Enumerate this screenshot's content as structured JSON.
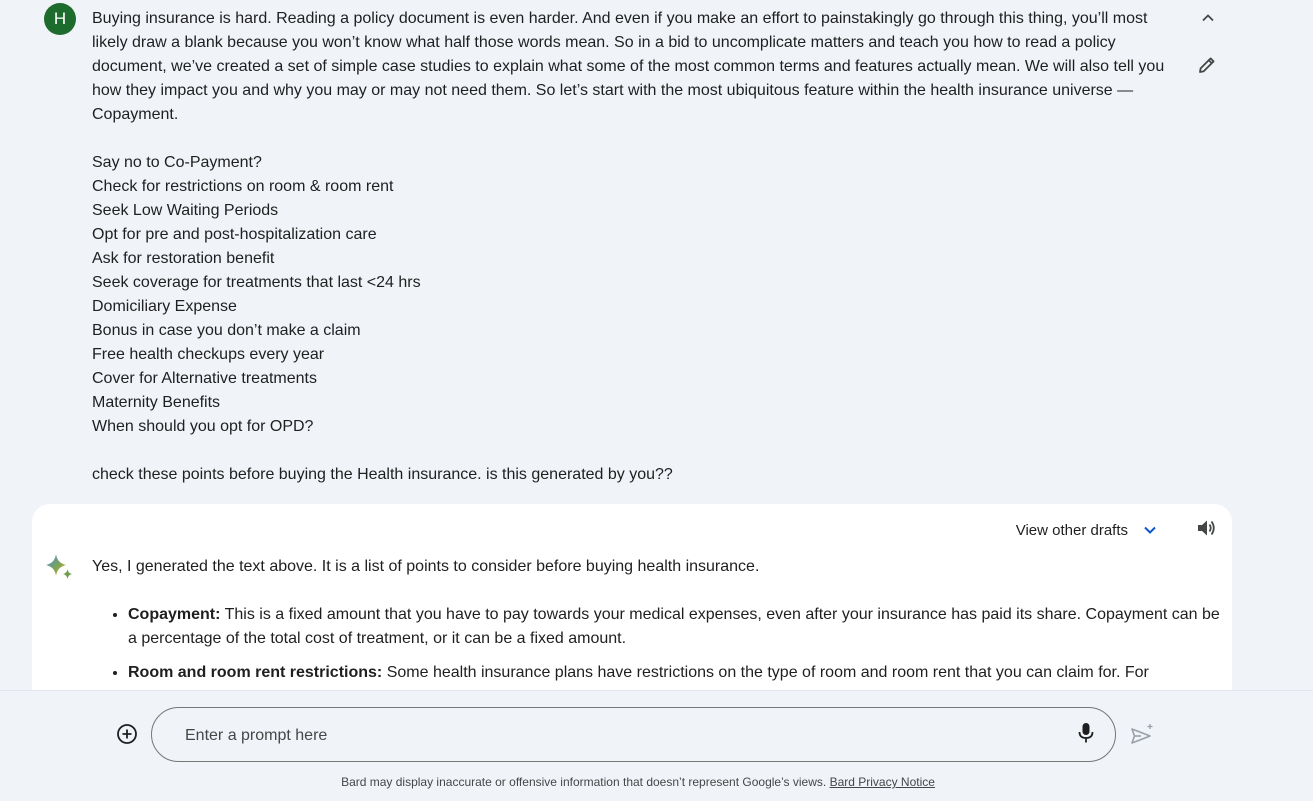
{
  "user": {
    "avatar_letter": "H",
    "paragraph": "Buying insurance is hard. Reading a policy document is even harder. And even if you make an effort to painstakingly go through this thing, you’ll most likely draw a blank because you won’t know what half those words mean. So in a bid to uncomplicate matters and teach you how to read a policy document, we’ve created a set of simple case studies to explain what some of the most common terms and features actually mean. We will also tell you how they impact you and why you may or may not need them. So let’s start with the most ubiquitous feature within the health insurance universe — Copayment.",
    "list": [
      "Say no to Co-Payment?",
      "Check for restrictions on room & room rent",
      "Seek Low Waiting Periods",
      "Opt for pre and post-hospitalization care",
      "Ask for restoration benefit",
      "Seek coverage for treatments that last <24 hrs",
      "Domiciliary Expense",
      "Bonus in case you don’t make a claim",
      "Free health checkups every year",
      "Cover for Alternative treatments",
      "Maternity Benefits",
      "When should you opt for OPD?"
    ],
    "question": "check these points before buying the Health insurance. is this generated by you??",
    "icons": {
      "collapse": "chevron-up-icon",
      "edit": "pencil-icon"
    }
  },
  "response": {
    "drafts_label": "View other drafts",
    "intro": "Yes, I generated the text above. It is a list of points to consider before buying health insurance.",
    "bullets": [
      {
        "term": "Copayment:",
        "text": " This is a fixed amount that you have to pay towards your medical expenses, even after your insurance has paid its share. Copayment can be a percentage of the total cost of treatment, or it can be a fixed amount."
      },
      {
        "term": "Room and room rent restrictions:",
        "text": " Some health insurance plans have restrictions on the type of room and room rent that you can claim for. For"
      }
    ],
    "icons": {
      "drafts": "chevron-down-icon",
      "speaker": "speaker-icon",
      "logo": "bard-sparkle-icon"
    }
  },
  "input": {
    "placeholder": "Enter a prompt here",
    "value": "",
    "icons": {
      "add": "add-circle-icon",
      "mic": "microphone-icon",
      "send": "send-icon"
    }
  },
  "footer": {
    "disclaimer": "Bard may display inaccurate or offensive information that doesn’t represent Google’s views.",
    "privacy_link": "Bard Privacy Notice"
  },
  "colors": {
    "background": "#f0f4f9",
    "card": "#ffffff",
    "avatar": "#1e6b2e",
    "accent_blue": "#0b57d0",
    "text": "#1f1f1f"
  }
}
